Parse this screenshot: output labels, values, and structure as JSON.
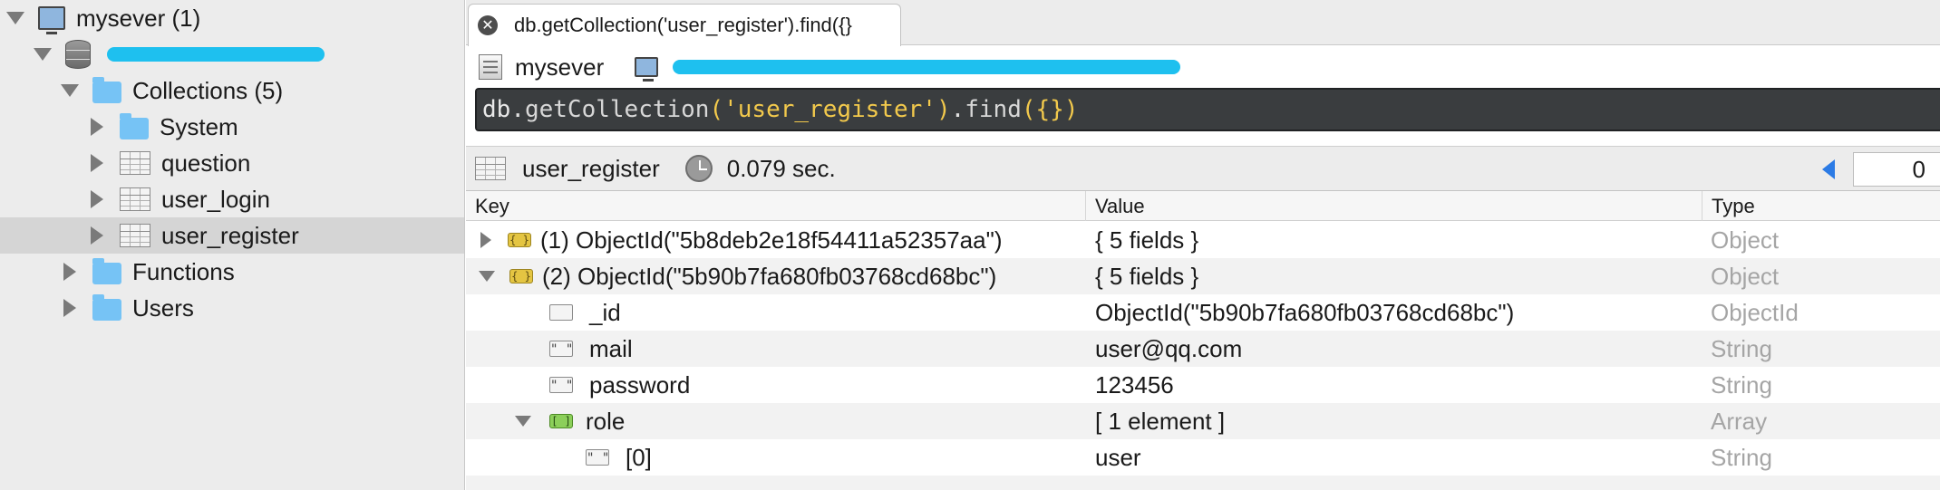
{
  "sidebar": {
    "server": "mysever (1)",
    "collections": "Collections (5)",
    "items": [
      {
        "label": "System",
        "icon": "folder-icon"
      },
      {
        "label": "question",
        "icon": "collection-icon"
      },
      {
        "label": "user_login",
        "icon": "collection-icon"
      },
      {
        "label": "user_register",
        "icon": "collection-icon"
      }
    ],
    "functions": "Functions",
    "users": "Users"
  },
  "tab": {
    "title": "db.getCollection('user_register').find({}"
  },
  "connection": {
    "server": "mysever"
  },
  "query": {
    "db": "db",
    "dot1": ".",
    "method1": "getCollection",
    "open1": "(",
    "collection": "'user_register'",
    "close1": ")",
    "dot2": ".",
    "method2": "find",
    "open2": "(",
    "arg": "{}",
    "close2": ")"
  },
  "result": {
    "collection": "user_register",
    "time": "0.079 sec.",
    "page": "0"
  },
  "table": {
    "headers": {
      "key": "Key",
      "value": "Value",
      "type": "Type"
    },
    "rows": [
      {
        "key": "(1) ObjectId(\"5b8deb2e18f54411a52357aa\")",
        "value": "{ 5 fields }",
        "type": "Object"
      },
      {
        "key": "(2) ObjectId(\"5b90b7fa680fb03768cd68bc\")",
        "value": "{ 5 fields }",
        "type": "Object"
      },
      {
        "key": "_id",
        "value": "ObjectId(\"5b90b7fa680fb03768cd68bc\")",
        "type": "ObjectId"
      },
      {
        "key": "mail",
        "value": "user@qq.com",
        "type": "String"
      },
      {
        "key": "password",
        "value": "123456",
        "type": "String"
      },
      {
        "key": "role",
        "value": "[ 1 element ]",
        "type": "Array"
      },
      {
        "key": "[0]",
        "value": "user",
        "type": "String"
      }
    ]
  },
  "colors": {
    "redaction": "#1ec0ef",
    "query_bg": "#3a3d3f",
    "string_literal": "#f2c94c",
    "selection": "#d5d5d5"
  }
}
